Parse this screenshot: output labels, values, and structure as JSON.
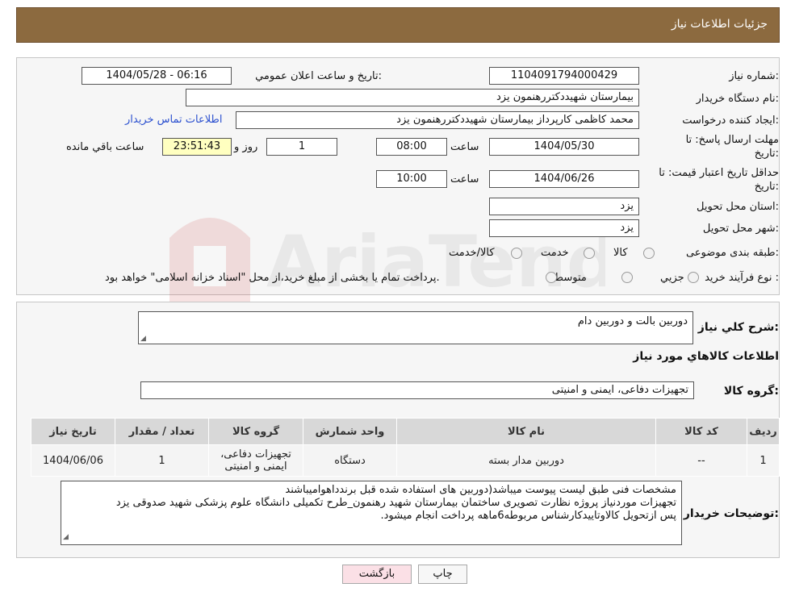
{
  "header": {
    "title": "جزئیات اطلاعات نیاز"
  },
  "form": {
    "need_number_label": "شماره نیاز:",
    "need_number": "1104091794000429",
    "announce_label": "تاريخ و ساعت اعلان عمومي:",
    "announce_value": "1404/05/28 - 06:16",
    "buyer_org_label": "نام دستگاه خريدار:",
    "buyer_org": "بيمارستان شهيددکتررهنمون يزد",
    "requester_label": "ايجاد کننده درخواست:",
    "requester": "محمد کاظمی کارپرداز بيمارستان شهيددکتررهنمون يزد",
    "contact_link": "اطلاعات تماس خريدار",
    "deadline_label_1": "مهلت ارسال پاسخ: تا",
    "deadline_label_2": "تاريخ:",
    "deadline_date": "1404/05/30",
    "time_label": "ساعت",
    "deadline_time": "08:00",
    "days_value": "1",
    "days_label": "روز و",
    "remaining_time": "23:51:43",
    "remaining_label": "ساعت باقي مانده",
    "validity_label_1": "حداقل تاريخ اعتبار قيمت: تا",
    "validity_label_2": "تاريخ:",
    "validity_date": "1404/06/26",
    "validity_time": "10:00",
    "province_label": "استان محل تحويل:",
    "province": "يزد",
    "city_label": "شهر محل تحويل:",
    "city": "يزد",
    "category_label": "طبقه بندی موضوعی:",
    "category_options": [
      "کالا",
      "خدمت",
      "کالا/خدمت"
    ],
    "process_label": "نوع فرآيند خريد :",
    "process_options": [
      "جزيي",
      "متوسط"
    ],
    "process_note": "پرداخت تمام يا بخشی از مبلغ خريد،از محل \"اسناد خزانه اسلامی\" خواهد بود."
  },
  "details": {
    "summary_label": "شرح کلي نياز:",
    "summary": "دوربین بالت و دوربین دام",
    "items_title": "اطلاعات کالاهاي مورد نياز",
    "group_label": "گروه کالا:",
    "group_value": "تجهیزات دفاعی، ایمنی و امنیتی",
    "table": {
      "headers": [
        "رديف",
        "کد کالا",
        "نام کالا",
        "واحد شمارش",
        "گروه کالا",
        "تعداد / مقدار",
        "تاريخ نياز"
      ],
      "rows": [
        [
          "1",
          "--",
          "دوربین مدار بسته",
          "دستگاه",
          "تجهیزات دفاعی، ایمنی و امنیتی",
          "1",
          "1404/06/06"
        ]
      ]
    },
    "buyer_notes_label": "توضيحات خريدار:",
    "buyer_notes": [
      "مشخصات فنی طبق لیست پیوست میباشد(دوربین های استفاده شده قبل برندداهوامیباشند",
      "تجهیزات موردنیاز پروژه نظارت تصویری ساختمان بیمارستان شهید رهنمون_طرح تکمیلی دانشگاه علوم پزشکی شهید صدوقی یزد",
      "پس ازتحویل کالاوتاییدکارشناس مربوطه6ماهه پرداخت انجام میشود."
    ]
  },
  "buttons": {
    "print": "چاپ",
    "back": "بازگشت"
  },
  "colors": {
    "header": "#8c6a3f",
    "link": "#2a4fcf",
    "remaining_bg": "#ffffc0",
    "back_bg": "#fbe0e6"
  }
}
